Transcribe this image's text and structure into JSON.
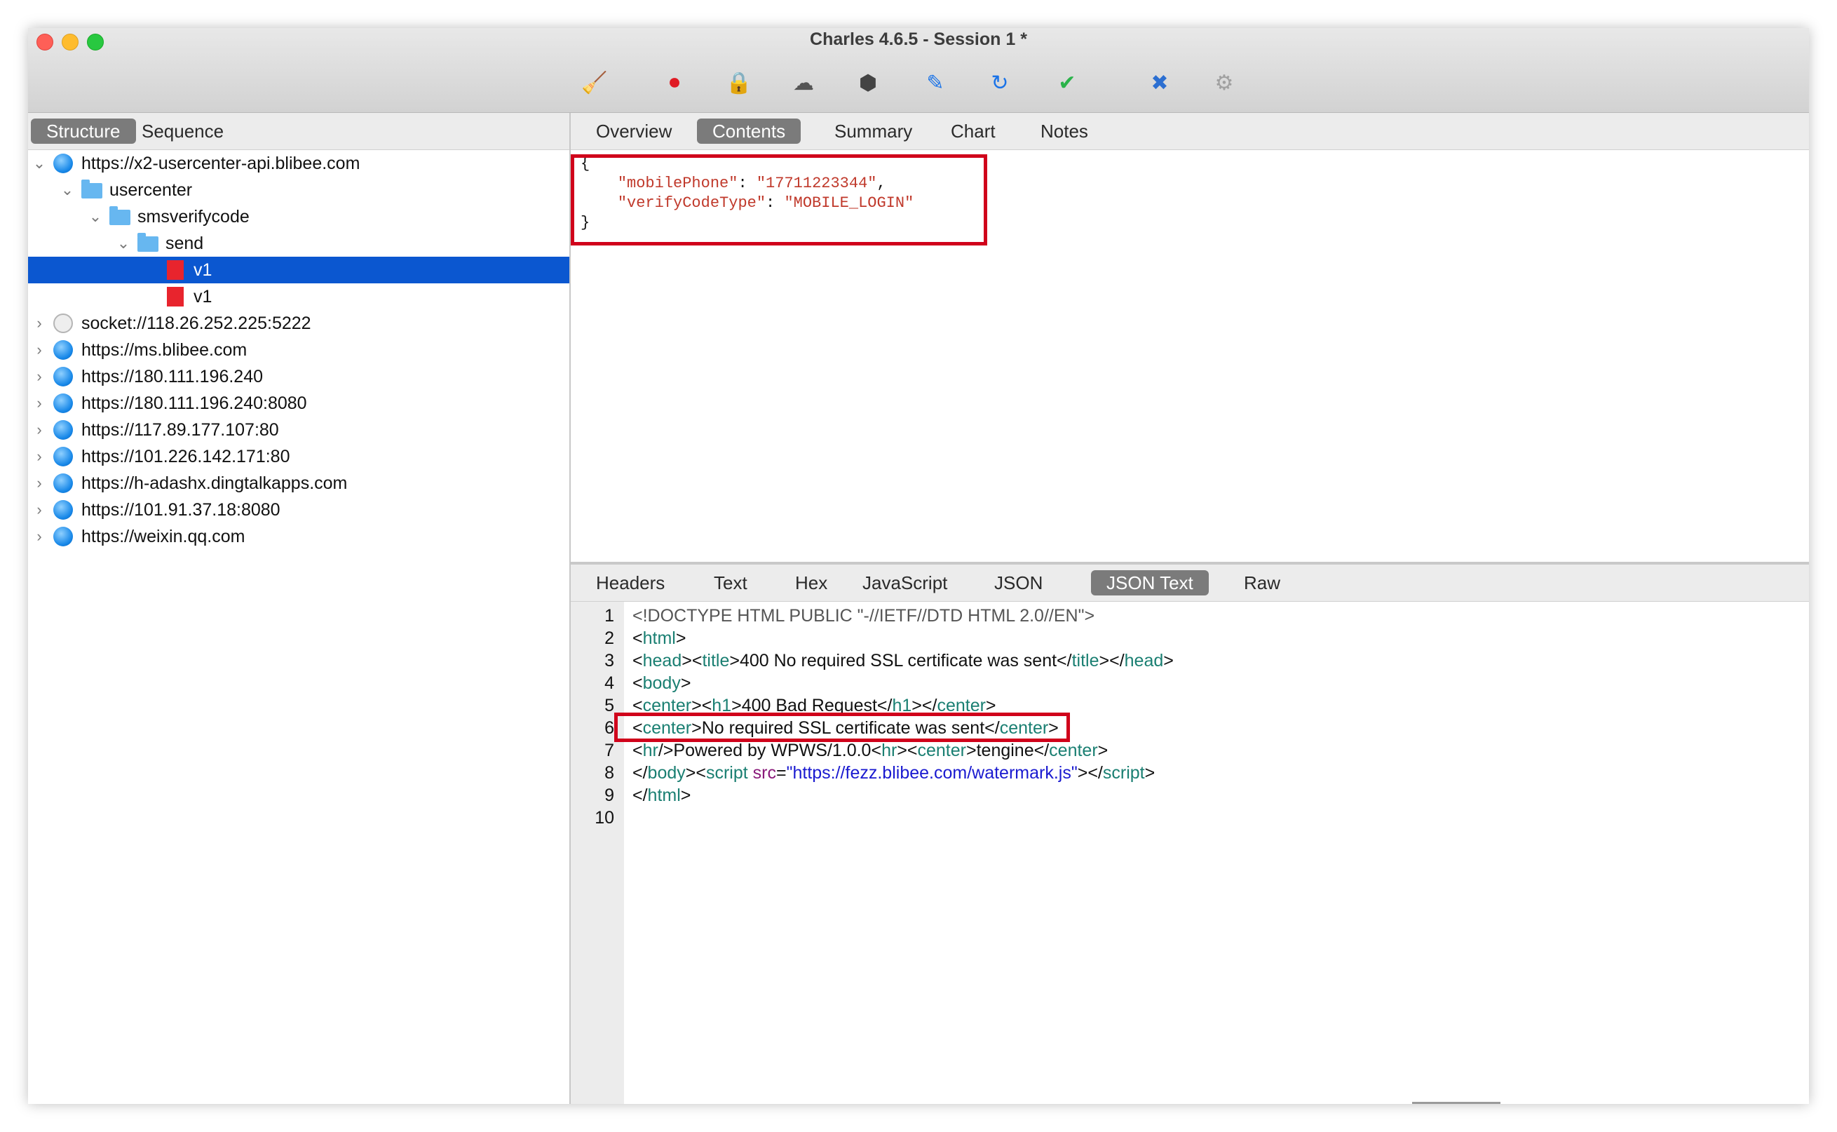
{
  "window": {
    "title": "Charles 4.6.5 - Session 1 *"
  },
  "toolbar": {
    "tools": [
      {
        "name": "broom-icon",
        "glyph": "🧹",
        "color": "#e0a800"
      },
      {
        "name": "record-icon",
        "glyph": "⏺",
        "color": "#e01b24"
      },
      {
        "name": "ssl-lock-icon",
        "glyph": "🔒",
        "color": "#8a8a8a"
      },
      {
        "name": "throttle-turtle-icon",
        "glyph": "☁",
        "color": "#555555"
      },
      {
        "name": "breakpoint-stop-icon",
        "glyph": "⬢",
        "color": "#444444"
      },
      {
        "name": "compose-pen-icon",
        "glyph": "✎",
        "color": "#1a73e8"
      },
      {
        "name": "repeat-icon",
        "glyph": "↻",
        "color": "#1a73e8"
      },
      {
        "name": "validate-check-icon",
        "glyph": "✔",
        "color": "#2bb34a"
      },
      {
        "name": "tools-icon",
        "glyph": "✖",
        "color": "#2c6fd1"
      },
      {
        "name": "settings-gear-icon",
        "glyph": "⚙",
        "color": "#a0a0a0"
      }
    ]
  },
  "left_tabs": {
    "structure": "Structure",
    "sequence": "Sequence"
  },
  "tree": {
    "root": "https://x2-usercenter-api.blibee.com",
    "usercenter": "usercenter",
    "smsverifycode": "smsverifycode",
    "send": "send",
    "v1a": "v1",
    "v1b": "v1",
    "socket": "socket://118.26.252.225:5222",
    "h1": "https://ms.blibee.com",
    "h2": "https://180.111.196.240",
    "h3": "https://180.111.196.240:8080",
    "h4": "https://117.89.177.107:80",
    "h5": "https://101.226.142.171:80",
    "h6": "https://h-adashx.dingtalkapps.com",
    "h7": "https://101.91.37.18:8080",
    "h8": "https://weixin.qq.com"
  },
  "right_tabs": {
    "overview": "Overview",
    "contents": "Contents",
    "summary": "Summary",
    "chart": "Chart",
    "notes": "Notes"
  },
  "request_body": {
    "open": "{",
    "k1": "\"mobilePhone\"",
    "v1": "\"17711223344\"",
    "k2": "\"verifyCodeType\"",
    "v2": "\"MOBILE_LOGIN\"",
    "close": "}"
  },
  "bottom_tabs": {
    "headers": "Headers",
    "text": "Text",
    "hex": "Hex",
    "javascript": "JavaScript",
    "json": "JSON",
    "json_text": "JSON Text",
    "raw": "Raw"
  },
  "response": {
    "line_numbers": [
      "1",
      "2",
      "3",
      "4",
      "5",
      "6",
      "7",
      "8",
      "9",
      "10"
    ],
    "l1": "<!DOCTYPE HTML PUBLIC \"-//IETF//DTD HTML 2.0//EN\">",
    "l2_tag": "html",
    "l3_title_text": "400 No required SSL certificate was sent",
    "l5_h1_text": "400 Bad Request",
    "l6_text": "No required SSL certificate was sent",
    "l7_text": "Powered by WPWS/1.0.0",
    "l7_text2": "tengine",
    "l8_src": "\"https://fezz.blibee.com/watermark.js\""
  }
}
